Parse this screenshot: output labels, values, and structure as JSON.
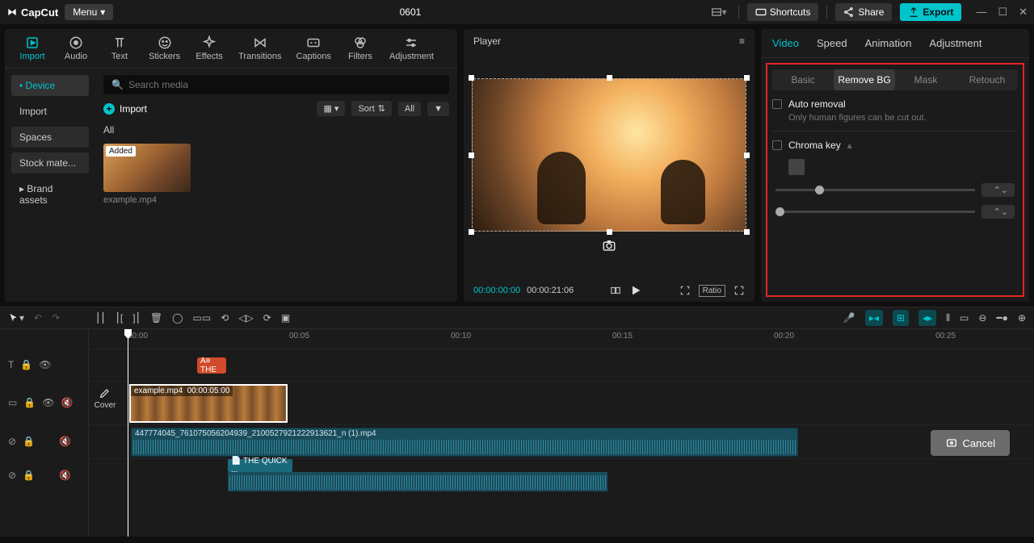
{
  "app": {
    "name": "CapCut",
    "menu_label": "Menu",
    "project_title": "0601"
  },
  "titlebar": {
    "shortcuts": "Shortcuts",
    "share": "Share",
    "export": "Export"
  },
  "media_tabs": {
    "import": "Import",
    "audio": "Audio",
    "text": "Text",
    "stickers": "Stickers",
    "effects": "Effects",
    "transitions": "Transitions",
    "captions": "Captions",
    "filters": "Filters",
    "adjustment": "Adjustment"
  },
  "media_side": {
    "device": "Device",
    "import": "Import",
    "spaces": "Spaces",
    "stock": "Stock mate...",
    "brand": "Brand assets"
  },
  "media_main": {
    "search_placeholder": "Search media",
    "import_label": "Import",
    "sort_label": "Sort",
    "all_btn": "All",
    "all_heading": "All"
  },
  "clip": {
    "badge": "Added",
    "filename": "example.mp4"
  },
  "player": {
    "title": "Player",
    "current_time": "00:00:00:00",
    "duration": "00:00:21:06",
    "ratio_label": "Ratio"
  },
  "props_tabs": {
    "video": "Video",
    "speed": "Speed",
    "animation": "Animation",
    "adjustment": "Adjustment"
  },
  "sub_tabs": {
    "basic": "Basic",
    "remove_bg": "Remove BG",
    "mask": "Mask",
    "retouch": "Retouch"
  },
  "props": {
    "auto_removal": "Auto removal",
    "auto_hint": "Only human figures can be cut out.",
    "chroma_key": "Chroma key"
  },
  "timeline": {
    "ruler": [
      "00:00",
      "00:05",
      "00:10",
      "00:15",
      "00:20",
      "00:25"
    ],
    "cover_label": "Cover",
    "video_clip_name": "example.mp4",
    "video_clip_time": "00:00:05:00",
    "text_chip": "A≡ THE",
    "audio1_name": "447774045_761075056204939_2100527921222913621_n (1).mp4",
    "audio2_label": "📄 THE QUICK ..."
  },
  "cancel_btn": "Cancel"
}
